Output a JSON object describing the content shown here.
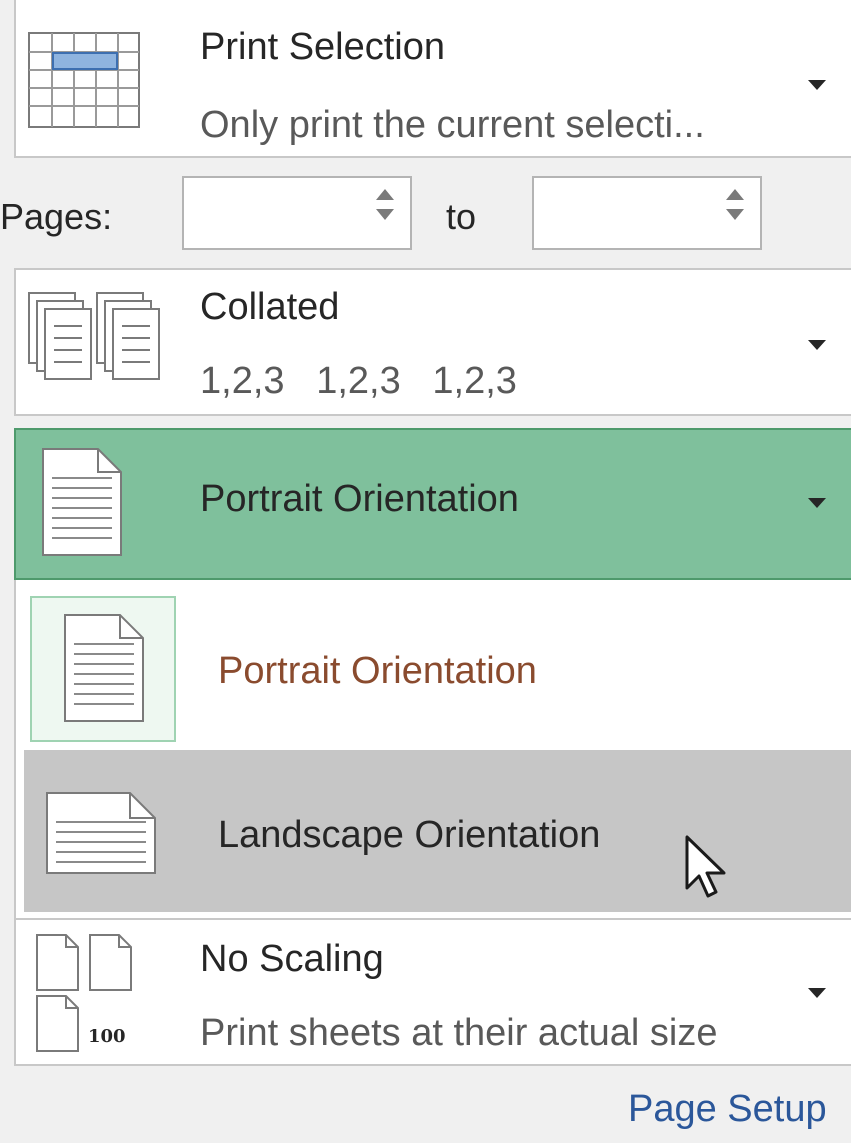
{
  "print_what": {
    "title": "Print Selection",
    "subtitle": "Only print the current selecti...",
    "icon": "grid-selection-icon"
  },
  "pages": {
    "label": "Pages:",
    "from_value": "",
    "to_label": "to",
    "to_value": ""
  },
  "collation": {
    "title": "Collated",
    "subtitle": "1,2,3   1,2,3   1,2,3",
    "icon": "collated-pages-icon"
  },
  "orientation": {
    "selected_label": "Portrait Orientation",
    "icon": "portrait-page-icon",
    "accent_color": "#7fc09c",
    "border_color": "#4e9a6c",
    "options": [
      {
        "label": "Portrait Orientation",
        "icon": "portrait-page-icon",
        "selected": true
      },
      {
        "label": "Landscape Orientation",
        "icon": "landscape-page-icon",
        "hovered": true
      }
    ]
  },
  "scaling": {
    "title": "No Scaling",
    "subtitle": "Print sheets at their actual size",
    "icon_text": "100",
    "icon": "scaling-pages-icon"
  },
  "page_setup_link": "Page Setup",
  "colors": {
    "link": "#2b579a",
    "hover_row": "#c6c6c6",
    "option_portrait_text": "#8a4b2e"
  }
}
